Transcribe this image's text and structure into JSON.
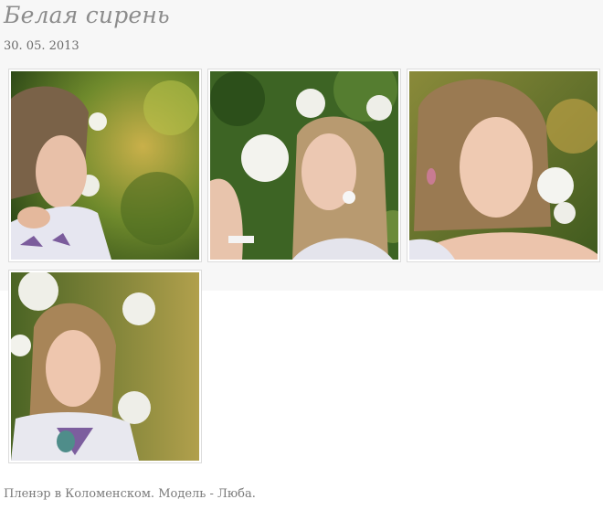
{
  "post": {
    "title": "Белая сирень",
    "date": "30. 05. 2013",
    "caption": "Пленэр в Коломенском. Модель - Люба."
  },
  "gallery": {
    "photos": [
      {
        "subject": "woman beside white lilac, profile"
      },
      {
        "subject": "woman smelling white lilac"
      },
      {
        "subject": "woman portrait with lilac, pink earring"
      },
      {
        "subject": "woman portrait among lilac with necklace"
      }
    ]
  }
}
